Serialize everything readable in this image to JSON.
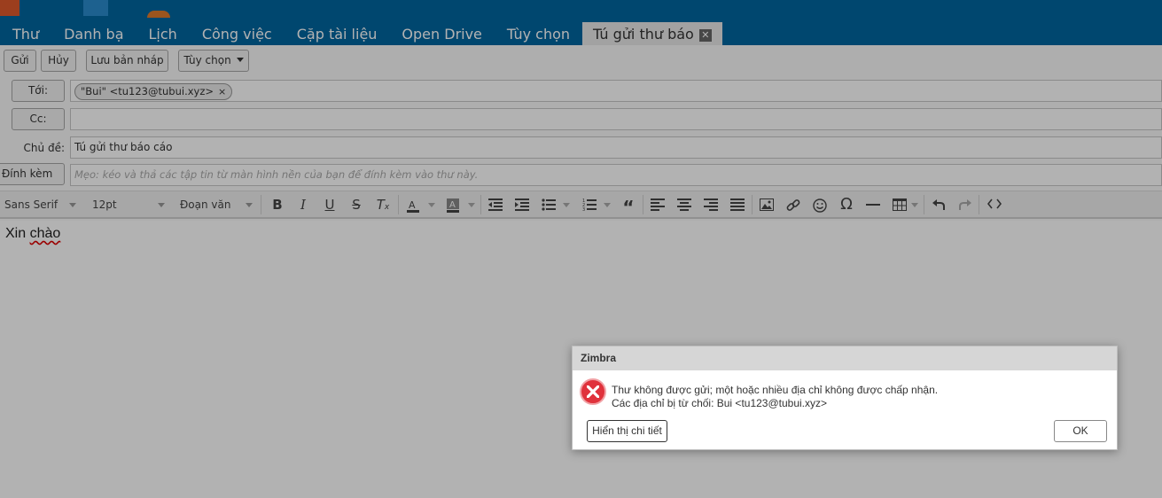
{
  "tabs": [
    {
      "label": "Thư"
    },
    {
      "label": "Danh bạ"
    },
    {
      "label": "Lịch"
    },
    {
      "label": "Công việc"
    },
    {
      "label": "Cặp tài liệu"
    },
    {
      "label": "Open Drive"
    },
    {
      "label": "Tùy chọn"
    },
    {
      "label": "Tú gửi thư báo",
      "active": true,
      "close_glyph": "✕"
    }
  ],
  "toolbar": {
    "send_label": "Gửi",
    "cancel_label": "Hủy",
    "save_draft_label": "Lưu bản nháp",
    "options_label": "Tùy chọn"
  },
  "compose": {
    "to_label": "Tới:",
    "to_recipient": "\"Bui\" <tu123@tubui.xyz>",
    "chip_remove": "×",
    "cc_label": "Cc:",
    "subject_label": "Chủ đề:",
    "subject_value": "Tú gửi thư báo cáo",
    "attach_label": "Đính kèm",
    "attach_hint": "Mẹo: kéo và thả các tập tin từ màn hình nền của bạn để đính kèm vào thư này."
  },
  "editor_toolbar": {
    "font_family": "Sans Serif",
    "font_size": "12pt",
    "block_format": "Đoạn văn",
    "icons": [
      "bold-icon",
      "italic-icon",
      "underline-icon",
      "strikethrough-icon",
      "clear-format-icon",
      "text-color-icon",
      "highlight-color-icon",
      "align-justify-icon",
      "indent-icon",
      "bullet-list-icon",
      "numbered-list-icon",
      "blockquote-icon",
      "align-left-icon",
      "align-center-icon",
      "align-right-icon",
      "justify-icon",
      "image-icon",
      "link-icon",
      "emoji-icon",
      "special-char-icon",
      "horizontal-rule-icon",
      "table-icon",
      "undo-icon",
      "redo-icon",
      "source-code-icon"
    ]
  },
  "editor": {
    "word1": "Xin",
    "word2": "chào"
  },
  "dialog": {
    "title": "Zimbra",
    "message_line1": "Thư không được gửi; một hoặc nhiều địa chỉ không được chấp nhận.",
    "message_line2": "Các địa chỉ bị từ chối: Bui <tu123@tubui.xyz>",
    "details_button": "Hiển thị chi tiết",
    "ok_button": "OK"
  },
  "colors": {
    "header_bg": "#0066a0",
    "active_tab_bg": "#e9e9e9",
    "error_red": "#e0323c"
  }
}
